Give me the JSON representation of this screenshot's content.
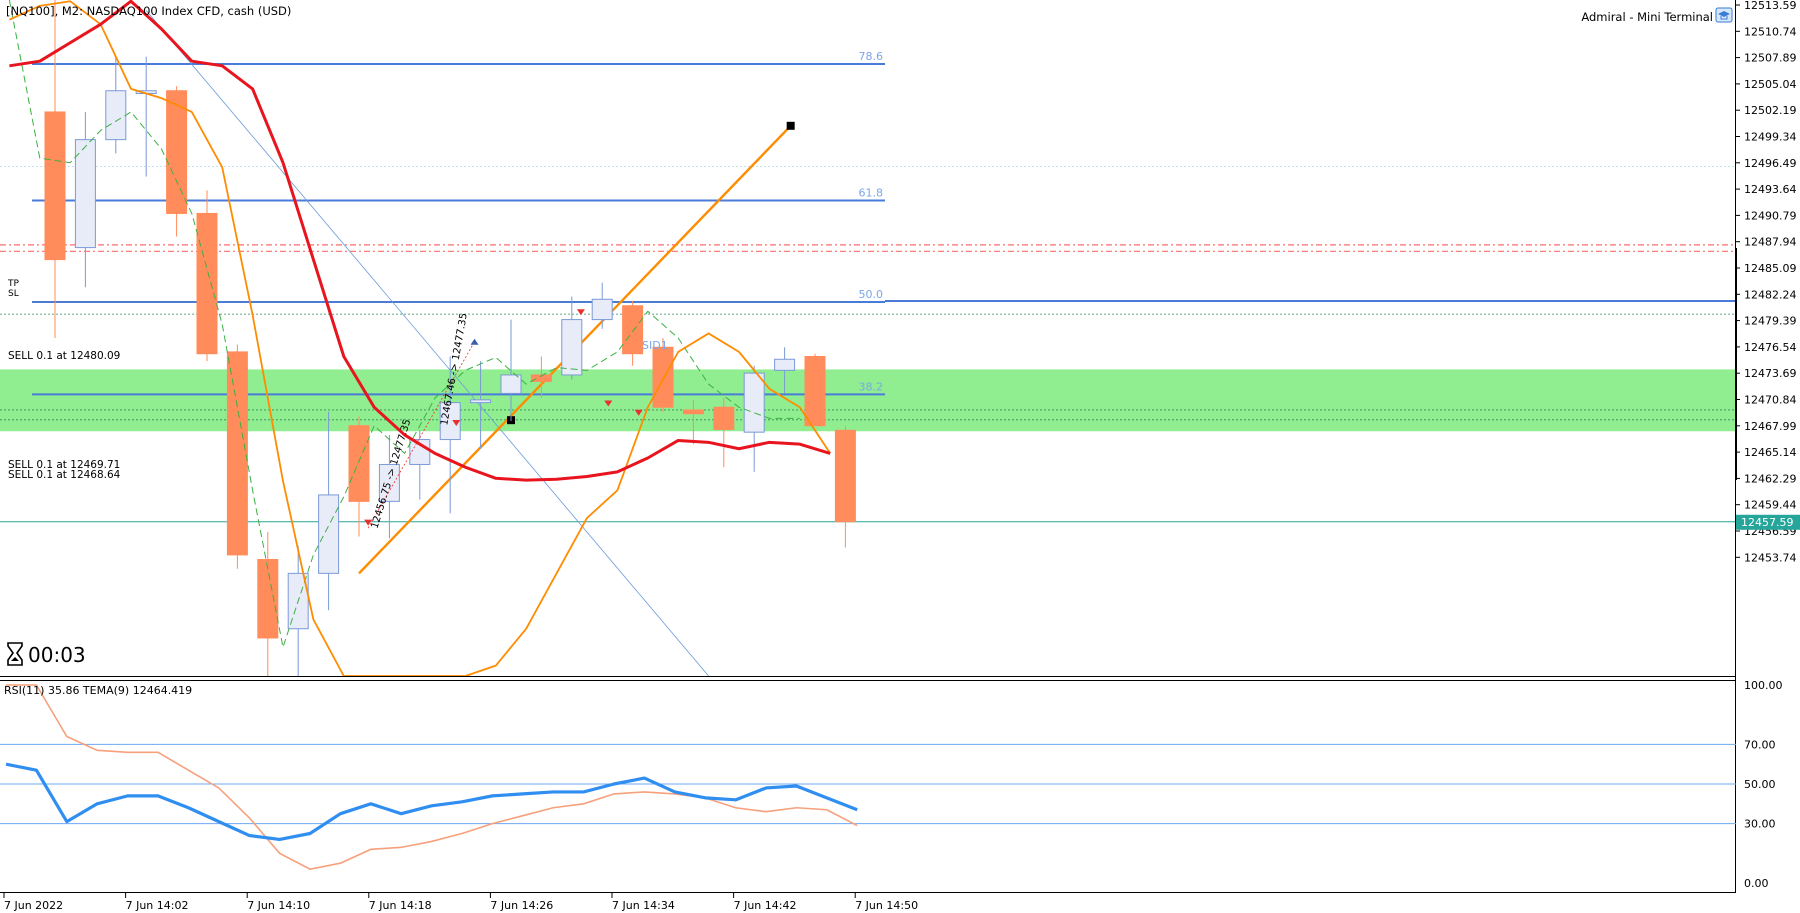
{
  "header": {
    "symbol_line": "[NQ100], M2:  NASDAQ100 Index CFD, cash (USD)",
    "terminal_label": "Admiral - Mini Terminal"
  },
  "timer": {
    "value": "00:03"
  },
  "current_price": {
    "label": "12457.59",
    "value": 12457.59,
    "color": "#26a69a"
  },
  "x_axis_labels": [
    "7 Jun 2022",
    "7 Jun 14:02",
    "7 Jun 14:10",
    "7 Jun 14:18",
    "7 Jun 14:26",
    "7 Jun 14:34",
    "7 Jun 14:42",
    "7 Jun 14:50"
  ],
  "price_axis_labels": [
    "12513.59",
    "12510.74",
    "12507.89",
    "12505.04",
    "12502.19",
    "12499.34",
    "12496.49",
    "12493.64",
    "12490.79",
    "12487.94",
    "12485.09",
    "12482.24",
    "12479.39",
    "12476.54",
    "12473.69",
    "12470.84",
    "12467.99",
    "12465.14",
    "12462.29",
    "12459.44",
    "12456.59",
    "12453.74"
  ],
  "fib_levels": [
    {
      "label": "78.6",
      "price": 12507.2
    },
    {
      "label": "61.8",
      "price": 12492.4
    },
    {
      "label": "50.0",
      "price": 12481.4
    },
    {
      "label": "38.2",
      "price": 12471.4
    }
  ],
  "order_labels": [
    {
      "text": "SELL 0.1 at 12480.09",
      "price": 12480.09
    },
    {
      "text": "SELL 0.1 at 12469.71",
      "price": 12469.71
    },
    {
      "text": "SELL 0.1 at 12468.64",
      "price": 12468.64
    }
  ],
  "sl_tp": {
    "tp_label": "TP",
    "sl_label": "SL",
    "price_a": 12487.6,
    "price_b": 12486.9
  },
  "level_label": "SID1",
  "trade_labels": [
    "12456.75 -> 12477.35",
    "12467.46 -> 12477.35"
  ],
  "colors": {
    "bull": "#e8ecf8",
    "bull_border": "#7a9ad8",
    "bear": "#ff8c5a",
    "zone": "#90ee90",
    "fib": "#4a7bd8",
    "ma_red": "#e8141e",
    "ma_orange": "#ff8c00",
    "rsi": "#2f8ef0",
    "tema": "#f7a07c"
  },
  "indicator": {
    "label": "RSI(11) 35.86 TEMA(9) 12464.419",
    "levels": [
      "100.00",
      "70.00",
      "50.00",
      "30.00",
      "0.00"
    ]
  },
  "chart_data": {
    "type": "candlestick",
    "symbol": "NQ100",
    "timeframe": "M2",
    "times": [
      "13:58",
      "14:00",
      "14:02",
      "14:04",
      "14:06",
      "14:08",
      "14:10",
      "14:12",
      "14:14",
      "14:16",
      "14:18",
      "14:20",
      "14:22",
      "14:24",
      "14:26",
      "14:28",
      "14:30",
      "14:32",
      "14:34",
      "14:36",
      "14:38",
      "14:40",
      "14:42",
      "14:44",
      "14:46",
      "14:48",
      "14:50",
      "14:52"
    ],
    "candles": [
      {
        "o": 12502.0,
        "h": 12520.0,
        "l": 12477.5,
        "c": 12486.0
      },
      {
        "o": 12487.3,
        "h": 12502.0,
        "l": 12483.0,
        "c": 12499.0
      },
      {
        "o": 12499.0,
        "h": 12508.0,
        "l": 12497.5,
        "c": 12504.3
      },
      {
        "o": 12504.0,
        "h": 12508.0,
        "l": 12495.0,
        "c": 12504.3
      },
      {
        "o": 12504.3,
        "h": 12504.8,
        "l": 12488.5,
        "c": 12491.0
      },
      {
        "o": 12491.0,
        "h": 12493.5,
        "l": 12475.0,
        "c": 12475.8
      },
      {
        "o": 12476.0,
        "h": 12476.8,
        "l": 12452.5,
        "c": 12454.0
      },
      {
        "o": 12453.5,
        "h": 12456.5,
        "l": 12440.0,
        "c": 12445.0
      },
      {
        "o": 12446.0,
        "h": 12455.0,
        "l": 12438.0,
        "c": 12452.0
      },
      {
        "o": 12452.0,
        "h": 12469.5,
        "l": 12448.0,
        "c": 12460.5
      },
      {
        "o": 12468.0,
        "h": 12469.0,
        "l": 12456.0,
        "c": 12459.8
      },
      {
        "o": 12459.8,
        "h": 12467.0,
        "l": 12455.8,
        "c": 12463.8
      },
      {
        "o": 12463.8,
        "h": 12467.5,
        "l": 12460.0,
        "c": 12466.5
      },
      {
        "o": 12466.5,
        "h": 12475.5,
        "l": 12458.5,
        "c": 12470.5
      },
      {
        "o": 12470.5,
        "h": 12475.0,
        "l": 12465.5,
        "c": 12470.8
      },
      {
        "o": 12471.5,
        "h": 12479.5,
        "l": 12468.5,
        "c": 12473.5
      },
      {
        "o": 12473.5,
        "h": 12475.5,
        "l": 12471.0,
        "c": 12472.8
      },
      {
        "o": 12473.5,
        "h": 12482.0,
        "l": 12473.0,
        "c": 12479.5
      },
      {
        "o": 12479.5,
        "h": 12483.5,
        "l": 12478.5,
        "c": 12481.7
      },
      {
        "o": 12481.0,
        "h": 12481.5,
        "l": 12474.5,
        "c": 12475.8
      },
      {
        "o": 12476.5,
        "h": 12477.5,
        "l": 12469.5,
        "c": 12470.0
      },
      {
        "o": 12469.7,
        "h": 12470.8,
        "l": 12466.0,
        "c": 12469.3
      },
      {
        "o": 12470.0,
        "h": 12471.0,
        "l": 12463.5,
        "c": 12467.6
      },
      {
        "o": 12467.3,
        "h": 12474.5,
        "l": 12463.0,
        "c": 12473.7
      },
      {
        "o": 12474.0,
        "h": 12476.5,
        "l": 12471.5,
        "c": 12475.2
      },
      {
        "o": 12475.5,
        "h": 12475.8,
        "l": 12468.0,
        "c": 12468.0
      },
      {
        "o": 12467.5,
        "h": 12468.0,
        "l": 12454.8,
        "c": 12457.6
      }
    ],
    "price_range": [
      12450.9,
      12514.0
    ],
    "highlight_zone": [
      12467.4,
      12474.1
    ],
    "ma_red": [
      12507,
      12507.5,
      12509.5,
      12511.5,
      12514,
      12511,
      12507.5,
      12507,
      12504.5,
      12496.5,
      12486,
      12475.5,
      12470,
      12467,
      12465,
      12463.5,
      12462.3,
      12462.1,
      12462.2,
      12462.5,
      12463,
      12464.5,
      12466.4,
      12466.2,
      12465.5,
      12466.2,
      12466.0,
      12465
    ],
    "ma_orange": [
      12512,
      12513.5,
      12514,
      12511.5,
      12504.5,
      12503.5,
      12502,
      12496,
      12480,
      12462,
      12447,
      12437,
      12428,
      12424,
      12429,
      12436,
      12442,
      12446,
      12452,
      12458,
      12461,
      12470,
      12476,
      12478,
      12476,
      12472,
      12470,
      12465
    ],
    "dashed_green": [
      12520.0,
      12497.0,
      12496.5,
      12500,
      12502,
      12498,
      12491,
      12479,
      12461,
      12444,
      12454,
      12460.3,
      12468.0,
      12465.0,
      12471.0,
      12474.0,
      12475.4,
      12472.5,
      12474.3,
      12474.0,
      12476.0,
      12480.4,
      12477.5,
      12472.5,
      12470.0,
      12468.8,
      12468.8
    ],
    "rsi": [
      60,
      57,
      31,
      40,
      44,
      44,
      38,
      31,
      24,
      22,
      25,
      35,
      40,
      35,
      39,
      41,
      44,
      45,
      46,
      46,
      50,
      53,
      46,
      43,
      42,
      48,
      49,
      43,
      37
    ],
    "tema_sub": [
      100,
      100,
      74,
      67,
      66,
      66,
      57,
      48,
      33,
      15,
      7,
      10,
      17,
      18,
      21,
      25,
      30,
      34,
      38,
      40,
      45,
      46,
      45,
      43,
      38,
      36,
      38,
      37,
      29
    ]
  }
}
